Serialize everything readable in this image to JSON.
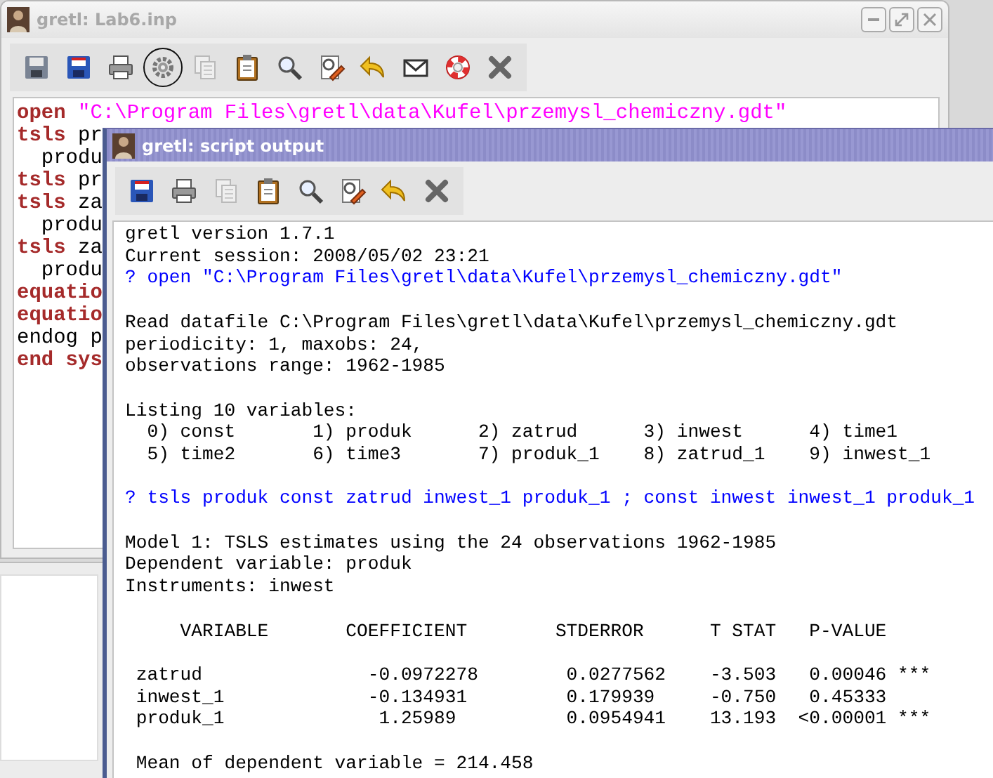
{
  "windows": [
    {
      "kind": "editor",
      "title": "gretl: Lab6.inp",
      "active": false,
      "toolbar": [
        {
          "kind": "save-as",
          "disabled": false,
          "highlighted": false
        },
        {
          "kind": "save",
          "disabled": false,
          "highlighted": false
        },
        {
          "kind": "print",
          "disabled": false,
          "highlighted": false
        },
        {
          "kind": "run",
          "disabled": false,
          "highlighted": true
        },
        {
          "kind": "copy",
          "disabled": true,
          "highlighted": false
        },
        {
          "kind": "paste",
          "disabled": false,
          "highlighted": false
        },
        {
          "kind": "find",
          "disabled": false,
          "highlighted": false
        },
        {
          "kind": "replace",
          "disabled": false,
          "highlighted": false
        },
        {
          "kind": "undo",
          "disabled": false,
          "highlighted": false
        },
        {
          "kind": "mail",
          "disabled": false,
          "highlighted": false
        },
        {
          "kind": "help",
          "disabled": false,
          "highlighted": false
        },
        {
          "kind": "close",
          "disabled": false,
          "highlighted": false
        }
      ],
      "lines": [
        [
          {
            "kind": "keyword",
            "text": "open"
          },
          {
            "kind": "string",
            "text": " \"C:\\Program Files\\gretl\\data\\Kufel\\przemysl_chemiczny.gdt\""
          }
        ],
        [
          {
            "kind": "keyword",
            "text": "tsls"
          },
          {
            "kind": "plain",
            "text": " pr"
          }
        ],
        [
          {
            "kind": "plain",
            "text": "  produ"
          }
        ],
        [
          {
            "kind": "keyword",
            "text": "tsls"
          },
          {
            "kind": "plain",
            "text": " pr"
          }
        ],
        [
          {
            "kind": "keyword",
            "text": "tsls"
          },
          {
            "kind": "plain",
            "text": " za"
          }
        ],
        [
          {
            "kind": "plain",
            "text": "  produ"
          }
        ],
        [
          {
            "kind": "keyword",
            "text": "tsls"
          },
          {
            "kind": "plain",
            "text": " za"
          }
        ],
        [
          {
            "kind": "plain",
            "text": "  produ"
          }
        ],
        [
          {
            "kind": "keyword",
            "text": "equatio"
          }
        ],
        [
          {
            "kind": "keyword",
            "text": "equatio"
          }
        ],
        [
          {
            "kind": "plain",
            "text": "endog p"
          }
        ],
        [
          {
            "kind": "keyword",
            "text": "end sys"
          }
        ]
      ]
    },
    {
      "kind": "output",
      "title": "gretl: script output",
      "active": true,
      "toolbar": [
        {
          "kind": "save",
          "disabled": false,
          "highlighted": false
        },
        {
          "kind": "print",
          "disabled": false,
          "highlighted": false
        },
        {
          "kind": "copy",
          "disabled": true,
          "highlighted": false
        },
        {
          "kind": "paste",
          "disabled": false,
          "highlighted": false
        },
        {
          "kind": "find",
          "disabled": false,
          "highlighted": false
        },
        {
          "kind": "replace",
          "disabled": false,
          "highlighted": false
        },
        {
          "kind": "undo",
          "disabled": false,
          "highlighted": false
        },
        {
          "kind": "close",
          "disabled": false,
          "highlighted": false
        }
      ],
      "blocks": [
        [
          {
            "kind": "output",
            "text": "gretl version 1.7.1"
          },
          {
            "kind": "output",
            "text": "Current session: 2008/05/02 23:21"
          },
          {
            "kind": "command",
            "text": "? open \"C:\\Program Files\\gretl\\data\\Kufel\\przemysl_chemiczny.gdt\""
          }
        ],
        [
          {
            "kind": "output",
            "text": "Read datafile C:\\Program Files\\gretl\\data\\Kufel\\przemysl_chemiczny.gdt"
          },
          {
            "kind": "output",
            "text": "periodicity: 1, maxobs: 24,"
          },
          {
            "kind": "output",
            "text": "observations range: 1962-1985"
          }
        ],
        [
          {
            "kind": "output",
            "text": "Listing 10 variables:"
          },
          {
            "kind": "output",
            "text": "  0) const       1) produk      2) zatrud      3) inwest      4) time1"
          },
          {
            "kind": "output",
            "text": "  5) time2       6) time3       7) produk_1    8) zatrud_1    9) inwest_1"
          }
        ],
        [
          {
            "kind": "command",
            "text": "? tsls produk const zatrud inwest_1 produk_1 ; const inwest inwest_1 produk_1"
          }
        ],
        [
          {
            "kind": "output",
            "text": "Model 1: TSLS estimates using the 24 observations 1962-1985"
          },
          {
            "kind": "output",
            "text": "Dependent variable: produk"
          },
          {
            "kind": "output",
            "text": "Instruments: inwest"
          }
        ],
        [
          {
            "kind": "output",
            "text": "     VARIABLE       COEFFICIENT        STDERROR      T STAT   P-VALUE"
          }
        ],
        [
          {
            "kind": "output",
            "text": " zatrud               -0.0972278        0.0277562    -3.503   0.00046 ***"
          },
          {
            "kind": "output",
            "text": " inwest_1             -0.134931         0.179939     -0.750   0.45333"
          },
          {
            "kind": "output",
            "text": " produk_1              1.25989          0.0954941    13.193  <0.00001 ***"
          }
        ],
        [
          {
            "kind": "output",
            "text": " Mean of dependent variable = 214.458"
          }
        ]
      ]
    }
  ]
}
